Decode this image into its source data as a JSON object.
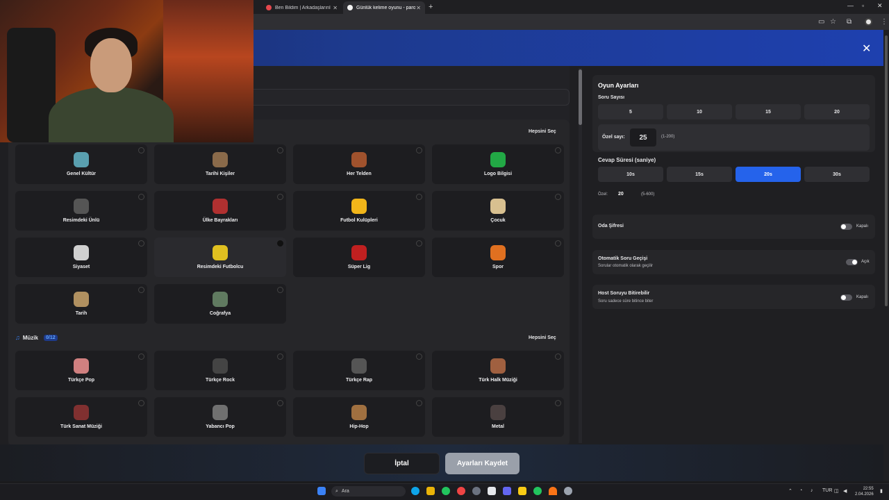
{
  "browser": {
    "tabs": [
      {
        "title": "Ben Bildim | Arkadaşlarınla Onl",
        "active": false,
        "favicon_color": "#e5484d"
      },
      {
        "title": "Günlük kelime oyunu - parolla",
        "active": true,
        "favicon_color": "#f2f2f2"
      }
    ]
  },
  "left": {
    "select_all": "Hepsini Seç",
    "categories_general": [
      {
        "label": "Genel Kültür",
        "icon": "globe-icon",
        "color": "#5aa0b0"
      },
      {
        "label": "Tarihi Kişiler",
        "icon": "portrait-icon",
        "color": "#8a6a4a"
      },
      {
        "label": "Her Telden",
        "icon": "mask-icon",
        "color": "#a0522d"
      },
      {
        "label": "Logo Bilgisi",
        "icon": "logo-icon",
        "color": "#22a845"
      },
      {
        "label": "Resimdeki Ünlü",
        "icon": "building-icon",
        "color": "#555"
      },
      {
        "label": "Ülke Bayrakları",
        "icon": "flag-icon",
        "color": "#b03030"
      },
      {
        "label": "Futbol Kulüpleri",
        "icon": "wolf-icon",
        "color": "#f2b61a"
      },
      {
        "label": "Çocuk",
        "icon": "carousel-icon",
        "color": "#d8c090"
      },
      {
        "label": "Siyaset",
        "icon": "podium-icon",
        "color": "#d0d0d0"
      },
      {
        "label": "Resimdeki Futbolcu",
        "icon": "footballer-icon",
        "color": "#e0c020"
      },
      {
        "label": "Süper Lig",
        "icon": "league-icon",
        "color": "#c02020"
      },
      {
        "label": "Spor",
        "icon": "ball-icon",
        "color": "#e07020"
      },
      {
        "label": "Tarih",
        "icon": "scroll-icon",
        "color": "#b09060"
      },
      {
        "label": "Coğrafya",
        "icon": "mountain-icon",
        "color": "#607a60"
      }
    ],
    "music": {
      "title": "Müzik",
      "count": "0/12",
      "select_all": "Hepsini Seç",
      "categories": [
        {
          "label": "Türkçe Pop",
          "icon": "pop-icon",
          "color": "#d08080"
        },
        {
          "label": "Türkçe Rock",
          "icon": "vinyl-icon",
          "color": "#444"
        },
        {
          "label": "Türkçe Rap",
          "icon": "microphone-icon",
          "color": "#555"
        },
        {
          "label": "Türk Halk Müziği",
          "icon": "folk-icon",
          "color": "#a06040"
        },
        {
          "label": "Türk Sanat Müziği",
          "icon": "art-music-icon",
          "color": "#803030"
        },
        {
          "label": "Yabancı Pop",
          "icon": "guitar-icon",
          "color": "#707070"
        },
        {
          "label": "Hip-Hop",
          "icon": "hiphop-icon",
          "color": "#a07040"
        },
        {
          "label": "Metal",
          "icon": "metal-icon",
          "color": "#4a4040"
        }
      ]
    }
  },
  "settings": {
    "title": "Oyun Ayarları",
    "question_count_label": "Soru Sayısı",
    "question_counts": [
      "5",
      "10",
      "15",
      "20"
    ],
    "custom_label": "Özel sayı:",
    "custom_value": "25",
    "custom_range": "(1-200)",
    "answer_time_label": "Cevap Süresi (saniye)",
    "answer_times": [
      "10s",
      "15s",
      "20s",
      "30s"
    ],
    "answer_time_selected": "20s",
    "custom_time_label": "Özel:",
    "custom_time_value": "20",
    "custom_time_range": "(5-600)",
    "room_password": {
      "label": "Oda Şifresi",
      "state": "Kapalı",
      "on": false
    },
    "auto_next": {
      "label": "Otomatik Soru Geçişi",
      "desc": "Sorular otomatik olarak geçilir",
      "state": "Açık",
      "on": true
    },
    "host_end": {
      "label": "Host Soruyu Bitirebilir",
      "desc": "Soru sadece süre bitince biter",
      "state": "Kapalı",
      "on": false
    }
  },
  "footer": {
    "cancel": "İptal",
    "save": "Ayarları Kaydet"
  },
  "taskbar": {
    "search": "Ara",
    "lang": "TUR",
    "time": "22:55",
    "date": "2.04.2026"
  }
}
